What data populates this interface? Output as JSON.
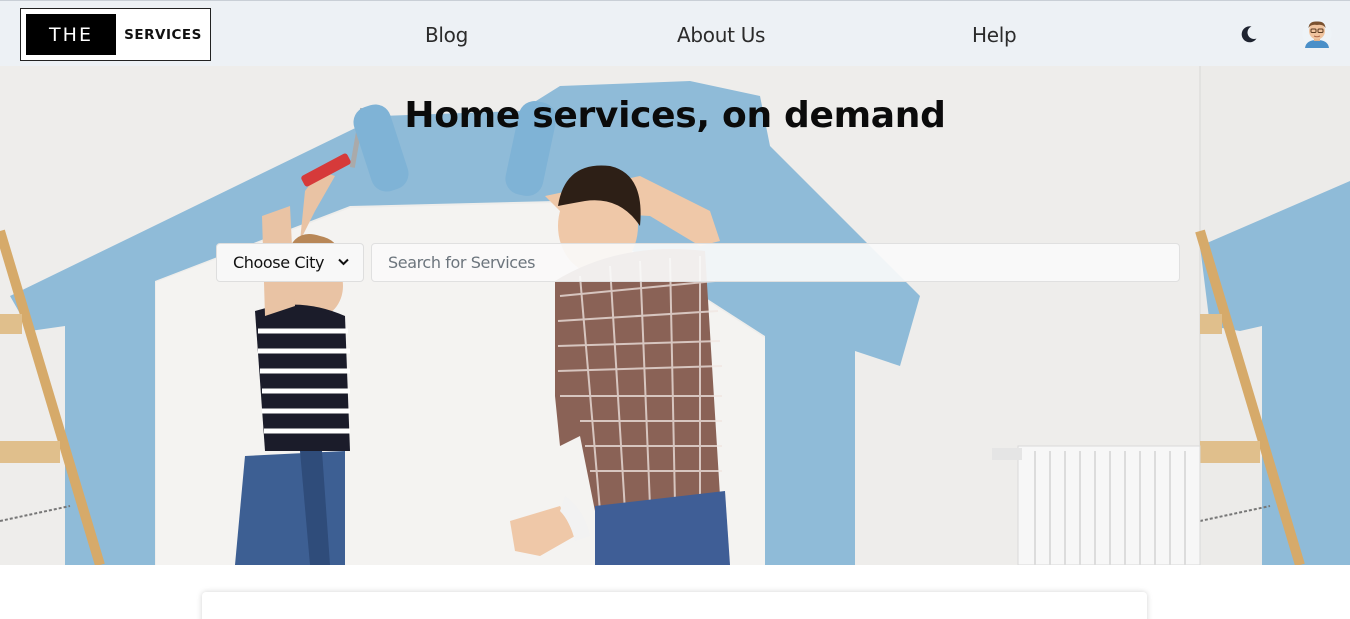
{
  "brand": {
    "logo_left": "THE",
    "logo_right": "SERVICES"
  },
  "nav": {
    "links": [
      {
        "label": "Blog"
      },
      {
        "label": "About Us"
      },
      {
        "label": "Help"
      }
    ],
    "theme_icon": "moon-icon",
    "avatar_icon": "user-avatar"
  },
  "hero": {
    "title": "Home services, on demand",
    "city_select": {
      "selected": "Choose City",
      "icon": "chevron-down-icon"
    },
    "search": {
      "placeholder": "Search for Services",
      "value": ""
    }
  },
  "colors": {
    "navbar_bg": "#edf1f5",
    "paint_blue": "#8fbbd8",
    "wall": "#ecebe9"
  }
}
